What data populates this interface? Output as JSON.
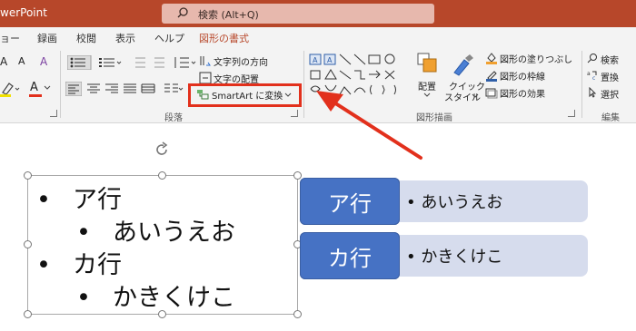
{
  "titlebar": {
    "app_title": "werPoint",
    "search_text": "検索 (Alt+Q)"
  },
  "tabs": [
    {
      "label": "ョー"
    },
    {
      "label": "録画"
    },
    {
      "label": "校閲"
    },
    {
      "label": "表示"
    },
    {
      "label": "ヘルプ"
    },
    {
      "label": "図形の書式",
      "active": true
    }
  ],
  "ribbon": {
    "font": {
      "size_up": "A",
      "size_down": "A",
      "clear_fmt": "A",
      "font_color": "A"
    },
    "paragraph": {
      "text_direction": "文字列の方向",
      "align_text": "文字の配置",
      "smartart": "SmartArt に変換",
      "group_label": "段落"
    },
    "drawing": {
      "arrange": "配置",
      "quick_styles": "クイック\nスタイル",
      "quick_styles_1": "クイック",
      "quick_styles_2": "スタイル",
      "fill": "図形の塗りつぶし",
      "outline": "図形の枠線",
      "effects": "図形の効果",
      "group_label": "図形描画"
    },
    "editing": {
      "find": "検索",
      "replace": "置換",
      "select": "選択",
      "group_label": "編集"
    }
  },
  "slide": {
    "textbox": {
      "lines": [
        {
          "level": 1,
          "bullet": "•",
          "text": "ア行"
        },
        {
          "level": 2,
          "bullet": "•",
          "text": "あいうえお"
        },
        {
          "level": 1,
          "bullet": "•",
          "text": "カ行"
        },
        {
          "level": 2,
          "bullet": "•",
          "text": "かきくけこ"
        }
      ]
    },
    "smartart": [
      {
        "header": "ア行",
        "detail": "• あいうえお"
      },
      {
        "header": "カ行",
        "detail": "• かきくけこ"
      }
    ]
  },
  "colors": {
    "brand": "#b7472a",
    "smartart_header": "#4672c4",
    "smartart_detail": "#d6dced",
    "highlight": "#e2301c"
  }
}
